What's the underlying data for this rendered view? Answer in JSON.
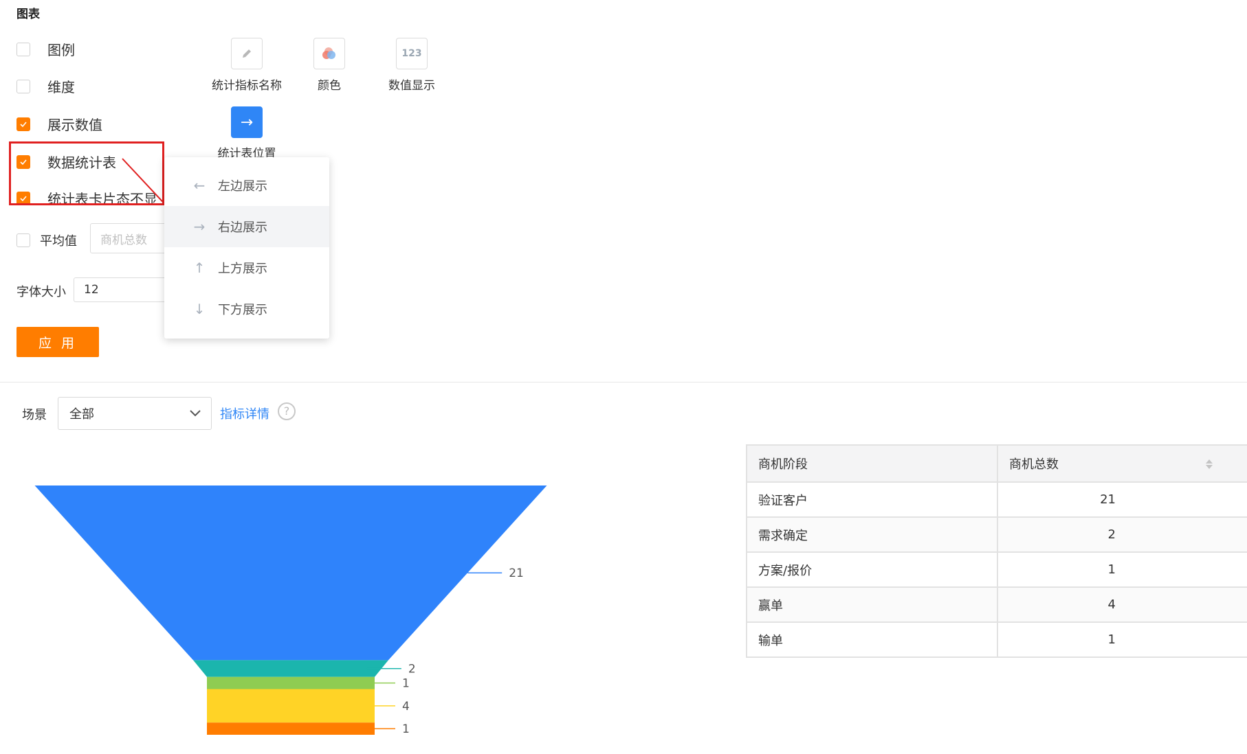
{
  "section_title": "图表",
  "options": {
    "legend": {
      "label": "图例",
      "checked": false
    },
    "dimension": {
      "label": "维度",
      "checked": false
    },
    "show_values": {
      "label": "展示数值",
      "checked": true
    },
    "data_table": {
      "label": "数据统计表",
      "checked": true
    },
    "table_card": {
      "label": "统计表卡片态不显",
      "checked": true
    },
    "average": {
      "label": "平均值",
      "checked": false,
      "placeholder": "商机总数"
    },
    "font_size": {
      "label": "字体大小",
      "value": "12"
    }
  },
  "icon_tiles": [
    {
      "label": "统计指标名称",
      "icon": "pencil-icon"
    },
    {
      "label": "颜色",
      "icon": "color-palette-icon"
    },
    {
      "label": "数值显示",
      "icon": "number-123-icon",
      "glyph": "123"
    },
    {
      "label": "统计表位置",
      "icon": "arrow-right-icon",
      "glyph": "→",
      "active_color": "#2f86f6"
    }
  ],
  "position_menu": [
    {
      "label": "左边展示",
      "glyph": "←",
      "active": false
    },
    {
      "label": "右边展示",
      "glyph": "→",
      "active": true
    },
    {
      "label": "上方展示",
      "glyph": "↑",
      "active": false
    },
    {
      "label": "下方展示",
      "glyph": "↓",
      "active": false
    }
  ],
  "apply_label": "应 用",
  "filter": {
    "scene_label": "场景",
    "scene_value": "全部",
    "metric_link": "指标详情",
    "help_glyph": "?"
  },
  "chart_data": {
    "type": "funnel",
    "categories": [
      "验证客户",
      "需求确定",
      "方案/报价",
      "赢单",
      "输单"
    ],
    "values": [
      21,
      2,
      1,
      4,
      1
    ],
    "colors": [
      "#2f83fb",
      "#1bb5ad",
      "#8fcc52",
      "#ffd326",
      "#ff7d00"
    ]
  },
  "table": {
    "headers": [
      "商机阶段",
      "商机总数"
    ],
    "rows": [
      [
        "验证客户",
        "21"
      ],
      [
        "需求确定",
        "2"
      ],
      [
        "方案/报价",
        "1"
      ],
      [
        "赢单",
        "4"
      ],
      [
        "输单",
        "1"
      ]
    ]
  },
  "colors": {
    "accent": "#ff7d00",
    "link": "#2f86f6",
    "highlight": "#e02020"
  }
}
